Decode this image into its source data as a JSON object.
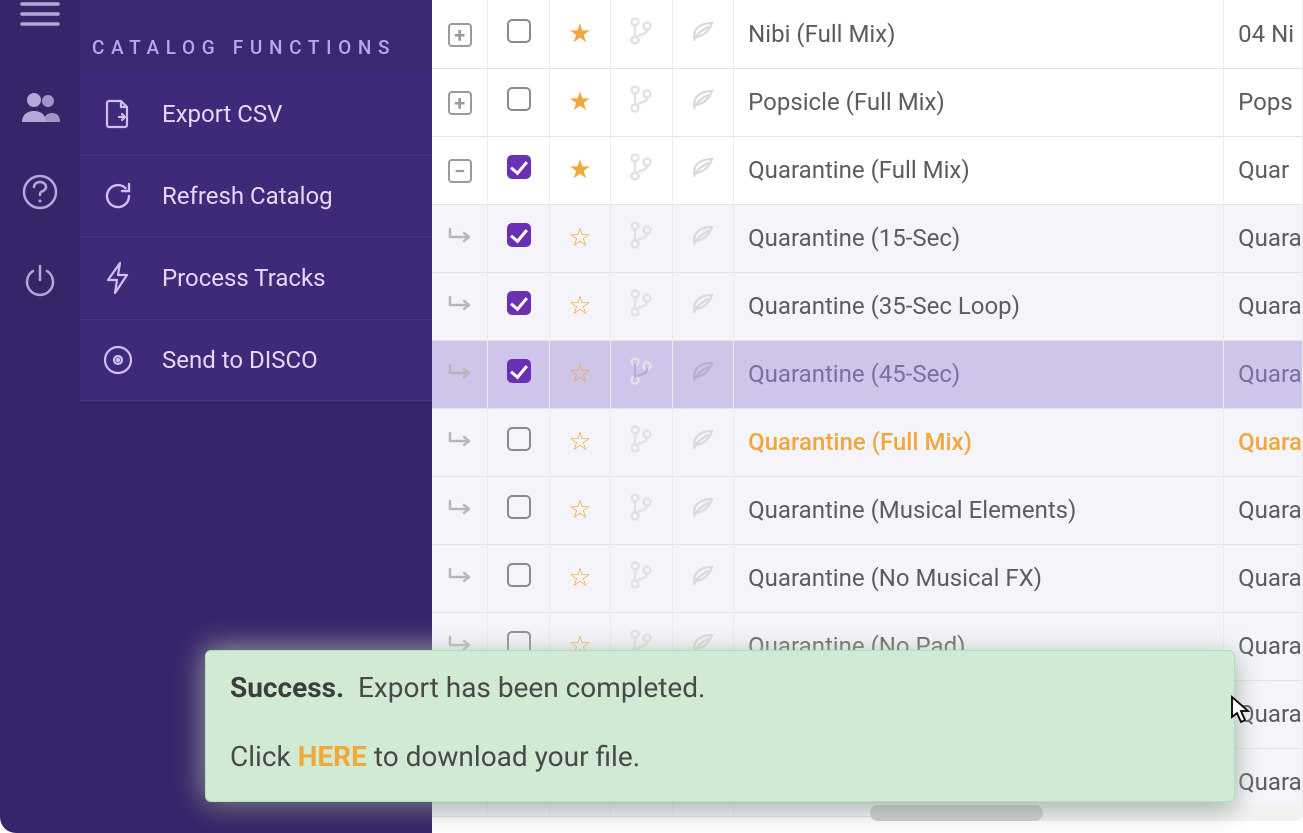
{
  "sidebar": {
    "section_title": "CATALOG FUNCTIONS",
    "items": [
      {
        "label": "Export CSV",
        "icon": "file-export-icon"
      },
      {
        "label": "Refresh Catalog",
        "icon": "refresh-icon"
      },
      {
        "label": "Process Tracks",
        "icon": "bolt-icon"
      },
      {
        "label": "Send to DISCO",
        "icon": "disc-icon"
      }
    ]
  },
  "rail": {
    "items": [
      "menu-icon",
      "users-icon",
      "help-icon",
      "power-icon"
    ]
  },
  "tracks": [
    {
      "kind": "parent",
      "expand": "plus",
      "checked": false,
      "star": "filled",
      "title": "Nibi (Full Mix)",
      "title2": "04 Ni",
      "highlight": false
    },
    {
      "kind": "parent",
      "expand": "plus",
      "checked": false,
      "star": "filled",
      "title": "Popsicle (Full Mix)",
      "title2": "Pops",
      "highlight": false
    },
    {
      "kind": "parent",
      "expand": "minus",
      "checked": true,
      "star": "filled",
      "title": "Quarantine (Full Mix)",
      "title2": "Quar",
      "highlight": false
    },
    {
      "kind": "child",
      "checked": true,
      "star": "outline",
      "title": "Quarantine (15-Sec)",
      "title2": "Quara",
      "highlight": false
    },
    {
      "kind": "child",
      "checked": true,
      "star": "outline",
      "title": "Quarantine (35-Sec Loop)",
      "title2": "Quara",
      "highlight": false
    },
    {
      "kind": "child",
      "checked": true,
      "star": "outline",
      "title": "Quarantine (45-Sec)",
      "title2": "Quara",
      "highlight": false,
      "selected": true
    },
    {
      "kind": "child",
      "checked": false,
      "star": "outline",
      "title": "Quarantine (Full Mix)",
      "title2": "Quara",
      "highlight": true
    },
    {
      "kind": "child",
      "checked": false,
      "star": "outline",
      "title": "Quarantine (Musical Elements)",
      "title2": "Quara",
      "highlight": false
    },
    {
      "kind": "child",
      "checked": false,
      "star": "outline",
      "title": "Quarantine (No Musical FX)",
      "title2": "Quara",
      "highlight": false
    },
    {
      "kind": "child",
      "checked": false,
      "star": "outline",
      "title": "Quarantine (No Pad)",
      "title2": "Quara",
      "highlight": false
    },
    {
      "kind": "child",
      "checked": false,
      "star": "outline",
      "title": "",
      "title2": "Quara",
      "highlight": false
    },
    {
      "kind": "child",
      "checked": false,
      "star": "outline",
      "title": "",
      "title2": "Quara",
      "highlight": false
    }
  ],
  "toast": {
    "strong": "Success.",
    "line1_rest": "Export has been completed.",
    "line2_pre": "Click",
    "line2_link": "HERE",
    "line2_post": "to download your file."
  }
}
